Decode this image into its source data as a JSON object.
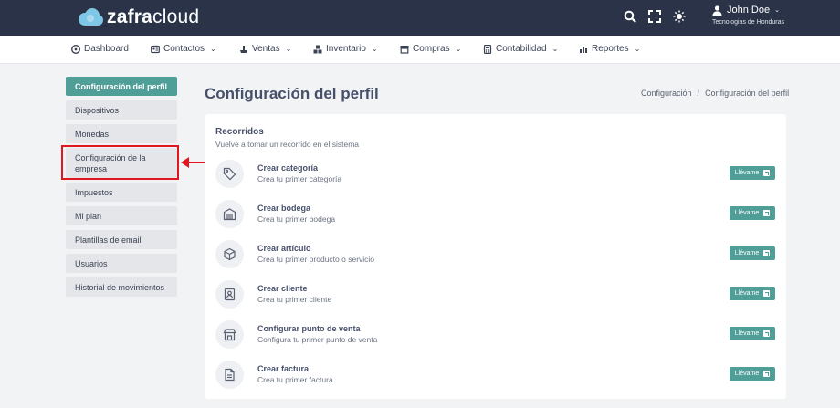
{
  "header": {
    "brand_bold": "zafra",
    "brand_light": "cloud",
    "icons": [
      "search-icon",
      "fullscreen-icon",
      "theme-sun-icon"
    ],
    "user": {
      "name": "John Doe",
      "organization": "Tecnologias de Honduras",
      "icon": "user-icon"
    },
    "colors": {
      "background": "#2a3347",
      "logo_cloud": "#7fc7e6"
    }
  },
  "nav": {
    "items": [
      {
        "label": "Dashboard",
        "icon": "dashboard-icon",
        "dropdown": false
      },
      {
        "label": "Contactos",
        "icon": "contacts-icon",
        "dropdown": true
      },
      {
        "label": "Ventas",
        "icon": "sales-icon",
        "dropdown": true
      },
      {
        "label": "Inventario",
        "icon": "inventory-icon",
        "dropdown": true
      },
      {
        "label": "Compras",
        "icon": "purchases-icon",
        "dropdown": true
      },
      {
        "label": "Contabilidad",
        "icon": "accounting-icon",
        "dropdown": true
      },
      {
        "label": "Reportes",
        "icon": "reports-icon",
        "dropdown": true
      }
    ]
  },
  "sidebar": {
    "items": [
      {
        "label": "Configuración del perfil",
        "active": true
      },
      {
        "label": "Dispositivos",
        "active": false
      },
      {
        "label": "Monedas",
        "active": false
      },
      {
        "label": "Configuración de la empresa",
        "active": false,
        "highlighted": true
      },
      {
        "label": "Impuestos",
        "active": false
      },
      {
        "label": "Mi plan",
        "active": false
      },
      {
        "label": "Plantillas de email",
        "active": false
      },
      {
        "label": "Usuarios",
        "active": false
      },
      {
        "label": "Historial de movimientos",
        "active": false
      }
    ],
    "colors": {
      "active": "#4f9e98",
      "highlight": "#e0171f"
    }
  },
  "main": {
    "title": "Configuración del perfil",
    "breadcrumb": [
      "Configuración",
      "Configuración del perfil"
    ],
    "breadcrumb_sep": "/",
    "card": {
      "title": "Recorridos",
      "subtitle": "Vuelve a tomar un recorrido en el sistema",
      "button_label": "Llévame",
      "rows": [
        {
          "title": "Crear categoría",
          "subtitle": "Crea tu primer categoría",
          "icon": "tag-icon"
        },
        {
          "title": "Crear bodega",
          "subtitle": "Crea tu primer bodega",
          "icon": "warehouse-icon"
        },
        {
          "title": "Crear artículo",
          "subtitle": "Crea tu primer producto o servicio",
          "icon": "box-icon"
        },
        {
          "title": "Crear cliente",
          "subtitle": "Crea tu primer cliente",
          "icon": "contact-card-icon"
        },
        {
          "title": "Configurar punto de venta",
          "subtitle": "Configura tu primer punto de venta",
          "icon": "store-icon"
        },
        {
          "title": "Crear factura",
          "subtitle": "Crea tu primer factura",
          "icon": "invoice-icon"
        }
      ]
    }
  }
}
